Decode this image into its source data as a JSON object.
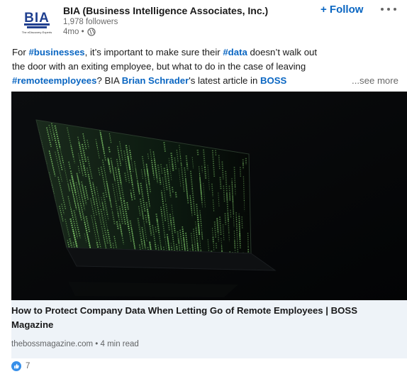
{
  "header": {
    "logo_text": "BIA",
    "logo_tagline": "The eDiscovery Experts",
    "company_name": "BIA (Business Intelligence Associates, Inc.)",
    "followers": "1,978 followers",
    "time": "4mo •",
    "visibility_icon": "globe-icon",
    "follow_label": "+ Follow",
    "more_icon": "ellipsis-icon"
  },
  "post": {
    "l1_pre": "For ",
    "l1_tag1": "#businesses",
    "l1_mid": ", it’s important to make sure their ",
    "l1_tag2": "#data",
    "l1_post": " doesn’t walk out",
    "l2": "the door with an exiting employee, but what to do in the case of leaving",
    "l3_tag": "#remoteemployees",
    "l3_mid": "? BIA ",
    "l3_mention": "Brian Schrader",
    "l3_mid2": "'s latest article in ",
    "l3_mention2": "BOSS",
    "see_more": "...see more"
  },
  "link_card": {
    "title": "How to Protect Company Data When Letting Go of Remote Employees | BOSS Magazine",
    "source": "thebossmagazine.com • 4 min read"
  },
  "reactions": {
    "icon": "like-icon",
    "count": "7"
  },
  "colors": {
    "link_blue": "#0a66c2",
    "logo_blue": "#1f3f8f",
    "card_bg": "#eef3f8",
    "matrix_green": "#7fc86a"
  }
}
